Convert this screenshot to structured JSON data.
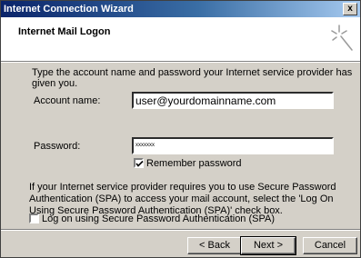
{
  "window": {
    "title": "Internet Connection Wizard",
    "close_glyph": "x"
  },
  "header": {
    "title": "Internet Mail Logon",
    "icon": "wizard-sparkle-icon"
  },
  "form": {
    "intro": "Type the account name and password your Internet service provider has given you.",
    "account_label": "Account name:",
    "account_value": "user@yourdomainname.com",
    "password_label": "Password:",
    "password_value": "xxxxxxx",
    "remember_label": "Remember password",
    "remember_checked": true,
    "spa_text": "If your Internet service provider requires you to use Secure Password Authentication (SPA) to access your mail account, select the 'Log On Using Secure Password Authentication (SPA)' check box.",
    "spa_label": "Log on using Secure Password Authentication (SPA)",
    "spa_checked": false
  },
  "buttons": {
    "back": "< Back",
    "next": "Next >",
    "cancel": "Cancel"
  }
}
